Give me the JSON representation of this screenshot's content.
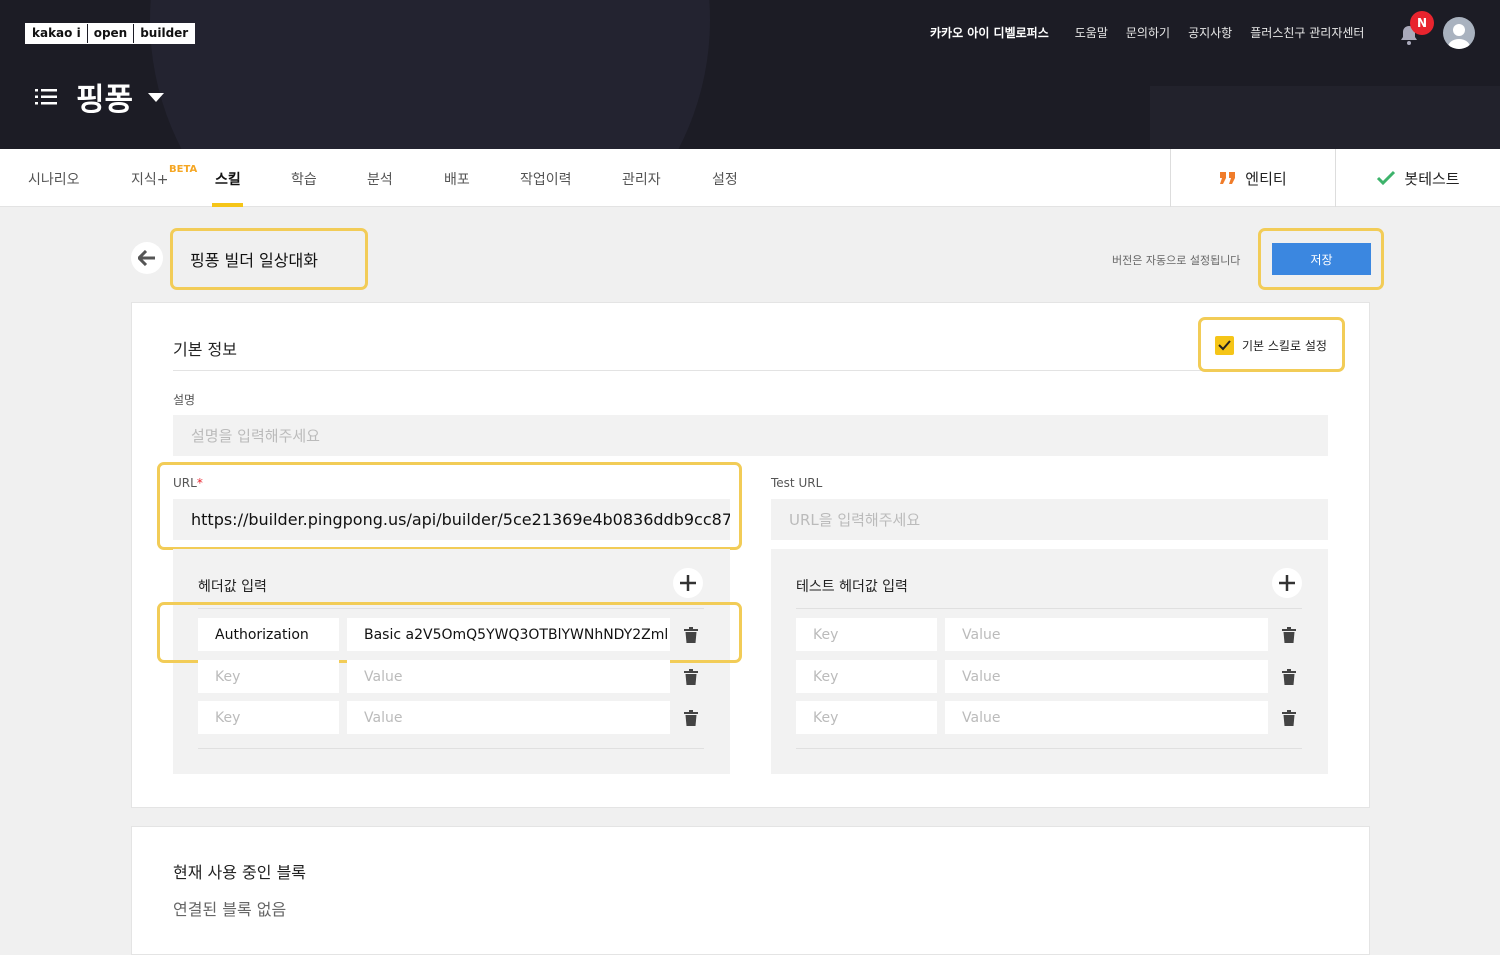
{
  "header": {
    "logo": [
      "kakao i",
      "open",
      "builder"
    ],
    "nav": [
      "카카오 아이 디벨로퍼스",
      "도움말",
      "문의하기",
      "공지사항",
      "플러스친구 관리자센터"
    ],
    "notification_badge": "N",
    "bot_name": "핑퐁"
  },
  "tabs": {
    "items": [
      "시나리오",
      "지식+",
      "스킬",
      "학습",
      "분석",
      "배포",
      "작업이력",
      "관리자",
      "설정"
    ],
    "beta": "BETA",
    "active": "스킬",
    "side": [
      "엔티티",
      "봇테스트"
    ]
  },
  "skill": {
    "title": "핑퐁 빌더 일상대화",
    "version_note": "버전은 자동으로 설정됩니다",
    "save_label": "저장"
  },
  "basic_info": {
    "title": "기본 정보",
    "default_skill_label": "기본 스킬로 설정",
    "default_skill_checked": true,
    "description_label": "설명",
    "description_placeholder": "설명을 입력해주세요",
    "url_label": "URL",
    "url_required": "*",
    "url_value": "https://builder.pingpong.us/api/builder/5ce21369e4b0836ddb9cc87",
    "test_url_label": "Test URL",
    "test_url_placeholder": "URL을 입력해주세요"
  },
  "headers": {
    "title": "헤더값 입력",
    "rows": [
      {
        "key": "Authorization",
        "value": "Basic a2V5OmQ5YWQ3OTBlYWNhNDY2Zml"
      },
      {
        "key": "",
        "value": ""
      },
      {
        "key": "",
        "value": ""
      }
    ],
    "key_placeholder": "Key",
    "value_placeholder": "Value"
  },
  "test_headers": {
    "title": "테스트 헤더값 입력",
    "key_placeholder": "Key",
    "value_placeholder": "Value"
  },
  "blocks": {
    "title": "현재 사용 중인 블록",
    "empty": "연결된 블록 없음"
  },
  "colors": {
    "header_bg": "#1c1c25",
    "accent_yellow": "#f5c518",
    "highlight": "#f2cc57",
    "save_blue": "#3b87e0",
    "badge_red": "#e8242e",
    "entity_orange": "#f07c2a",
    "check_green": "#3db36b"
  },
  "icons": [
    "menu-icon",
    "caret-down-icon",
    "bell-icon",
    "avatar-icon",
    "back-arrow-icon",
    "quote-icon",
    "check-icon",
    "plus-icon",
    "trash-icon"
  ]
}
